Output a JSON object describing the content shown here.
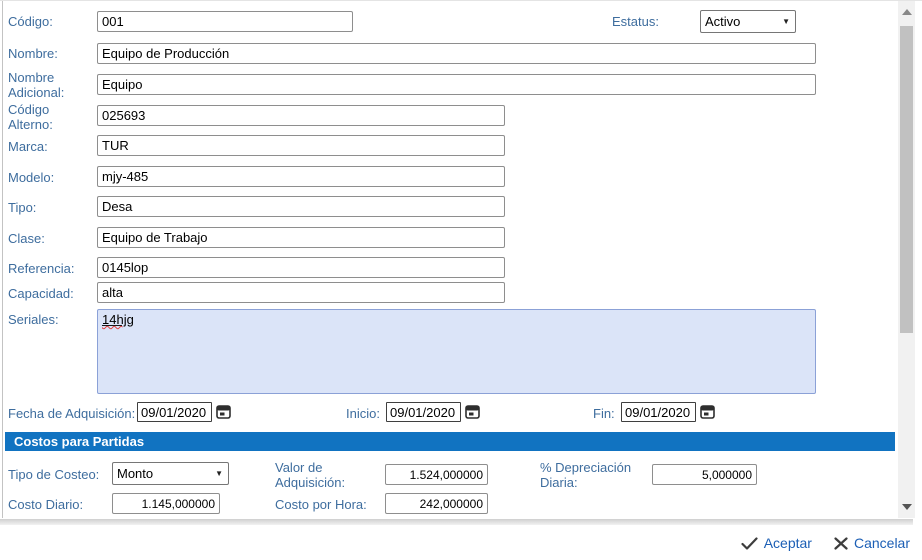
{
  "form": {
    "fields": {
      "codigo": {
        "label": "Código:",
        "value": "001"
      },
      "estatus": {
        "label": "Estatus:",
        "value": "Activo"
      },
      "nombre": {
        "label": "Nombre:",
        "value": "Equipo de Producción"
      },
      "nombre_adicional": {
        "label": "Nombre Adicional:",
        "value": "Equipo"
      },
      "codigo_alterno": {
        "label": "Código Alterno:",
        "value": "025693"
      },
      "marca": {
        "label": "Marca:",
        "value": "TUR"
      },
      "modelo": {
        "label": "Modelo:",
        "value": "mjy-485"
      },
      "tipo": {
        "label": "Tipo:",
        "value": "Desa"
      },
      "clase": {
        "label": "Clase:",
        "value": "Equipo de Trabajo"
      },
      "referencia": {
        "label": "Referencia:",
        "value": "0145lop"
      },
      "capacidad": {
        "label": "Capacidad:",
        "value": "alta"
      },
      "seriales": {
        "label": "Seriales:",
        "value": "14hjg"
      },
      "fecha_adquisicion": {
        "label": "Fecha de Adquisición:",
        "value": "09/01/2020"
      },
      "inicio": {
        "label": "Inicio:",
        "value": "09/01/2020"
      },
      "fin": {
        "label": "Fin:",
        "value": "09/01/2020"
      }
    },
    "section": {
      "title": "Costos para Partidas"
    },
    "costos": {
      "tipo_costeo": {
        "label": "Tipo de Costeo:",
        "value": "Monto"
      },
      "valor_adquisicion": {
        "label": "Valor de Adquisición:",
        "value": "1.524,000000"
      },
      "depreciacion": {
        "label": "% Depreciación Diaria:",
        "value": "5,000000"
      },
      "costo_diario": {
        "label": "Costo Diario:",
        "value": "1.145,000000"
      },
      "costo_hora": {
        "label": "Costo por Hora:",
        "value": "242,000000"
      }
    },
    "footer": {
      "aceptar": "Aceptar",
      "cancelar": "Cancelar"
    },
    "colors": {
      "header_bar": "#1173c1",
      "label": "#3e6d9e",
      "link": "#1c5fb5",
      "serials_bg": "#dbe4f8"
    }
  }
}
